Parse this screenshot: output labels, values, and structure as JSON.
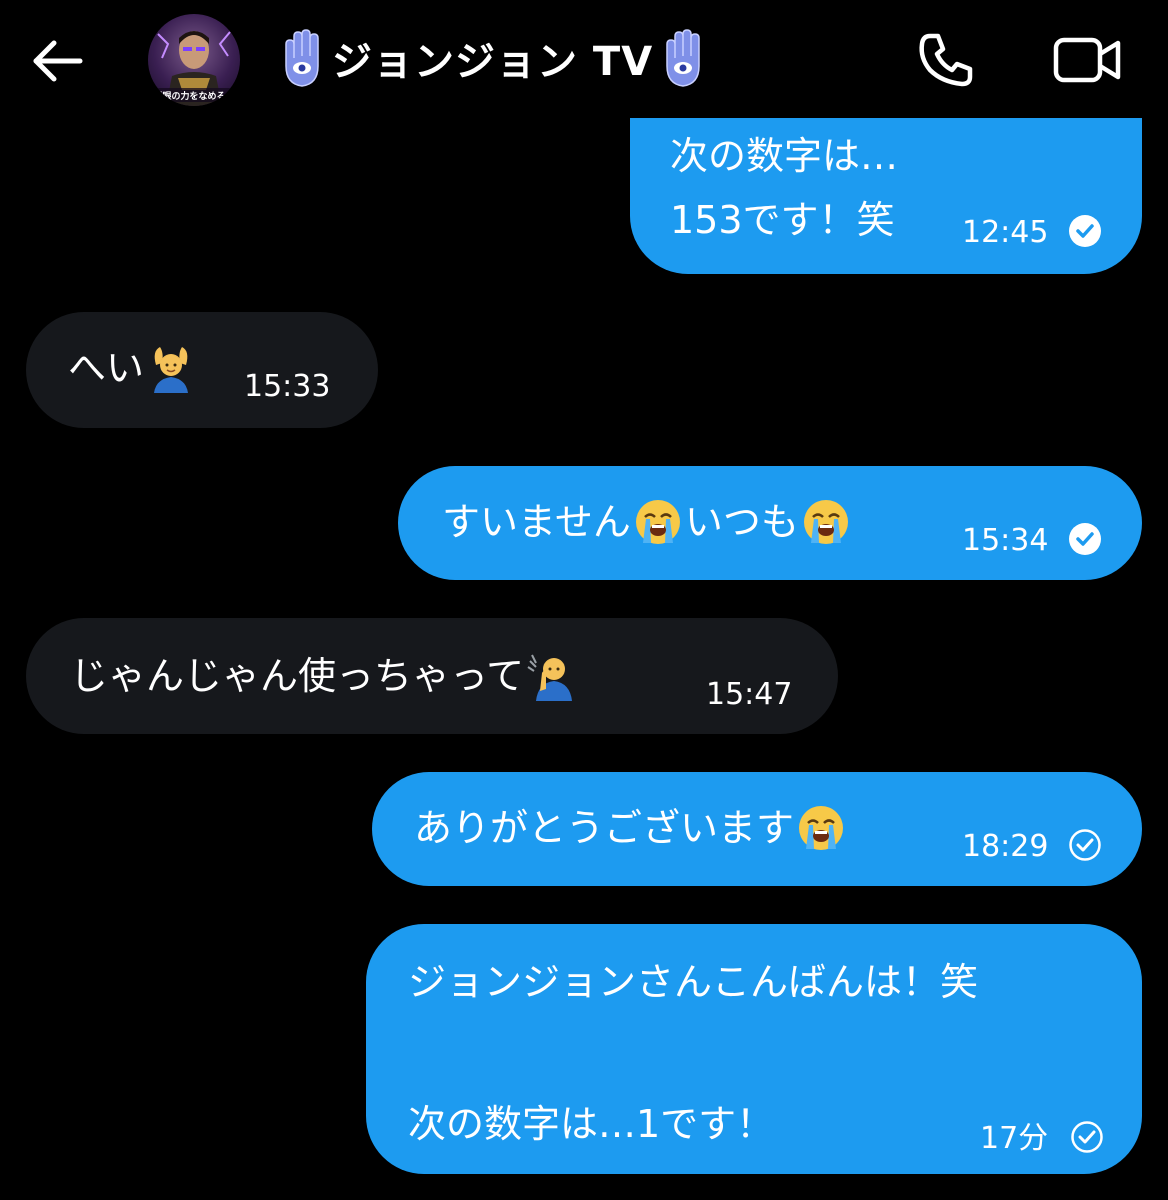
{
  "header": {
    "title": "ジョンジョン TV",
    "avatar_caption": "透眼の力をなめるな"
  },
  "messages": [
    {
      "direction": "out",
      "line1": "次の数字は…",
      "line2": "153です！笑",
      "time": "12:45",
      "status": "read"
    },
    {
      "direction": "in",
      "text": "へい",
      "emoji": "person-gesturing-ok-emoji",
      "time": "15:33"
    },
    {
      "direction": "out",
      "text_a": "すいません",
      "text_b": "いつも",
      "emoji": "loudly-crying-face-emoji",
      "time": "15:34",
      "status": "read"
    },
    {
      "direction": "in",
      "text": "じゃんじゃん使っちゃって",
      "emoji": "deaf-man-emoji",
      "time": "15:47"
    },
    {
      "direction": "out",
      "text": "ありがとうございます",
      "emoji": "loudly-crying-face-emoji",
      "time": "18:29",
      "status": "sent"
    },
    {
      "direction": "out",
      "line1": "ジョンジョンさんこんばんは！笑",
      "line2": "次の数字は…1です！",
      "time": "17分",
      "status": "sent"
    }
  ],
  "colors": {
    "background": "#000000",
    "outgoing_bubble": "#1d9bf0",
    "incoming_bubble": "#16181c",
    "hamsa": "#7f90e8"
  }
}
